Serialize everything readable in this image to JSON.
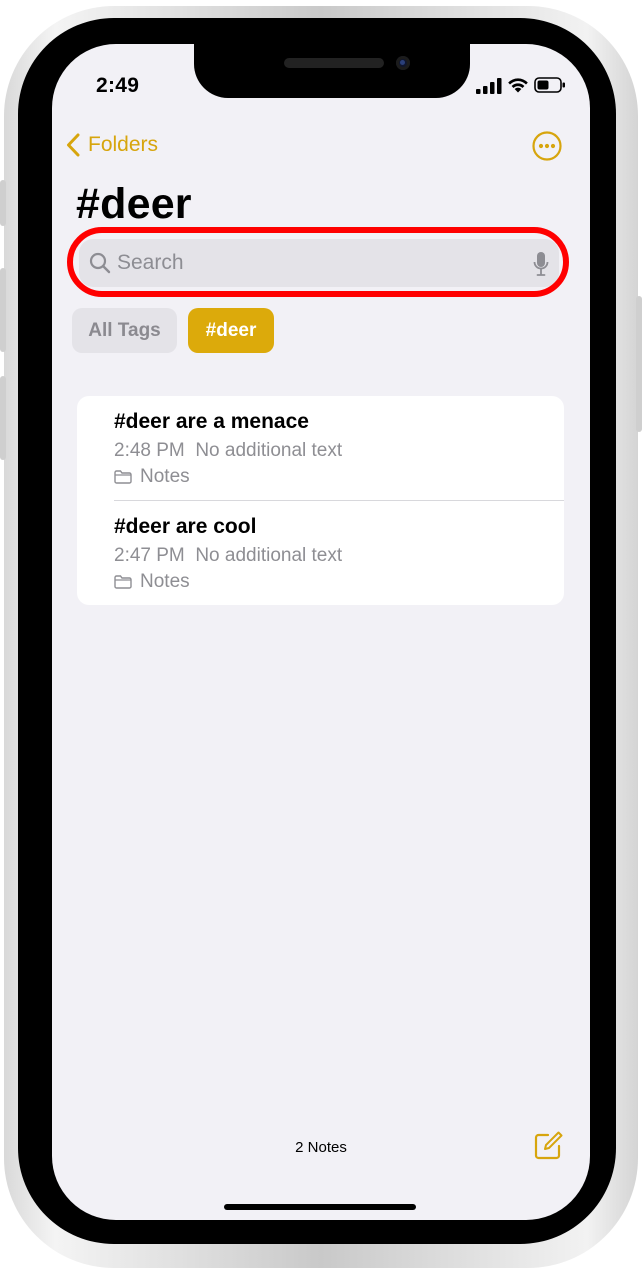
{
  "status_bar": {
    "time": "2:49"
  },
  "nav": {
    "back_label": "Folders"
  },
  "page": {
    "title": "#deer"
  },
  "search": {
    "placeholder": "Search"
  },
  "tags": [
    {
      "label": "All Tags",
      "selected": false
    },
    {
      "label": "#deer",
      "selected": true
    }
  ],
  "notes": [
    {
      "title": "#deer are a menace",
      "time": "2:48 PM",
      "preview": "No additional text",
      "folder": "Notes"
    },
    {
      "title": "#deer are cool",
      "time": "2:47 PM",
      "preview": "No additional text",
      "folder": "Notes"
    }
  ],
  "footer": {
    "count_label": "2 Notes"
  },
  "colors": {
    "accent": "#dcaa0b",
    "highlight": "#ff0000",
    "background": "#f2f1f6"
  },
  "icons": {
    "back": "chevron-left-icon",
    "more": "ellipsis-circle-icon",
    "search": "search-icon",
    "mic": "microphone-icon",
    "folder": "folder-icon",
    "compose": "compose-icon"
  }
}
